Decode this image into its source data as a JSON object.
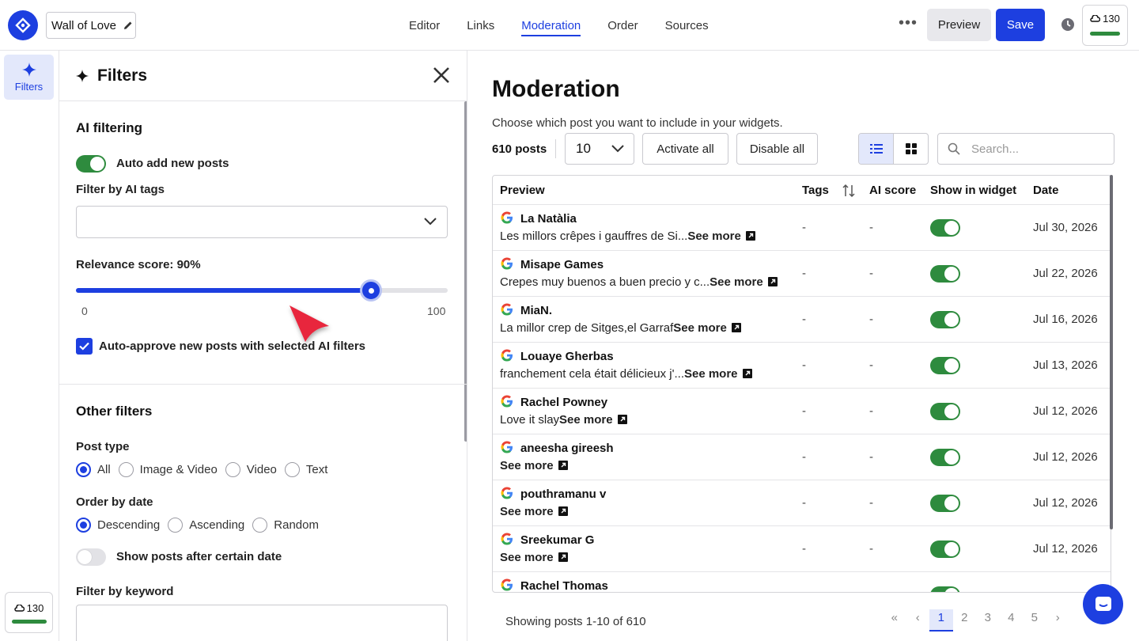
{
  "header": {
    "project_name": "Wall of Love",
    "tabs": [
      {
        "label": "Editor"
      },
      {
        "label": "Links"
      },
      {
        "label": "Moderation"
      },
      {
        "label": "Order"
      },
      {
        "label": "Sources"
      }
    ],
    "active_tab": "Moderation",
    "preview_label": "Preview",
    "save_label": "Save",
    "credits": "130"
  },
  "rail": {
    "filters_label": "Filters",
    "credits": "130"
  },
  "filters_panel": {
    "title": "Filters",
    "ai_filtering": {
      "title": "AI filtering",
      "auto_add_label": "Auto add new posts",
      "auto_add_on": true,
      "filter_tags_label": "Filter by AI tags",
      "relevance_label": "Relevance score: 90%",
      "relevance_value": 90,
      "slider_min": "0",
      "slider_max": "100",
      "auto_approve_label": "Auto-approve new posts with selected AI filters",
      "auto_approve_checked": true
    },
    "other_filters": {
      "title": "Other filters",
      "post_type_label": "Post type",
      "post_type_options": [
        "All",
        "Image & Video",
        "Video",
        "Text"
      ],
      "post_type_selected": "All",
      "order_label": "Order by date",
      "order_options": [
        "Descending",
        "Ascending",
        "Random"
      ],
      "order_selected": "Descending",
      "show_after_date_label": "Show posts after certain date",
      "show_after_date_on": false,
      "keyword_label": "Filter by keyword"
    }
  },
  "moderation": {
    "title": "Moderation",
    "subtitle": "Choose which post you want to include in your widgets.",
    "post_count": "610 posts",
    "per_page": "10",
    "activate_all": "Activate all",
    "disable_all": "Disable all",
    "search_placeholder": "Search...",
    "columns": [
      "Preview",
      "Tags",
      "AI score",
      "Show in widget",
      "Date"
    ],
    "rows": [
      {
        "name": "La Natàlia",
        "snippet": "Les millors crêpes i gauffres de Si...",
        "see_more": "See more",
        "tags": "-",
        "ai_score": "-",
        "shown": true,
        "date": "Jul 30, 2026"
      },
      {
        "name": "Misape Games",
        "snippet": "Crepes muy buenos a buen precio y c...",
        "see_more": "See more",
        "tags": "-",
        "ai_score": "-",
        "shown": true,
        "date": "Jul 22, 2026"
      },
      {
        "name": "MiaN.",
        "snippet": "La millor crep de Sitges,el Garraf",
        "see_more": "See more",
        "tags": "-",
        "ai_score": "-",
        "shown": true,
        "date": "Jul 16, 2026"
      },
      {
        "name": "Louaye Gherbas",
        "snippet": "franchement cela était délicieux j'...",
        "see_more": "See more",
        "tags": "-",
        "ai_score": "-",
        "shown": true,
        "date": "Jul 13, 2026"
      },
      {
        "name": "Rachel Powney",
        "snippet": "Love it slay",
        "see_more": "See more",
        "tags": "-",
        "ai_score": "-",
        "shown": true,
        "date": "Jul 12, 2026"
      },
      {
        "name": "aneesha gireesh",
        "snippet": "",
        "see_more": "See more",
        "tags": "-",
        "ai_score": "-",
        "shown": true,
        "date": "Jul 12, 2026"
      },
      {
        "name": "pouthramanu v",
        "snippet": "",
        "see_more": "See more",
        "tags": "-",
        "ai_score": "-",
        "shown": true,
        "date": "Jul 12, 2026"
      },
      {
        "name": "Sreekumar G",
        "snippet": "",
        "see_more": "See more",
        "tags": "-",
        "ai_score": "-",
        "shown": true,
        "date": "Jul 12, 2026"
      },
      {
        "name": "Rachel Thomas",
        "snippet": "",
        "see_more": "",
        "tags": "",
        "ai_score": "",
        "shown": true,
        "date": ""
      }
    ],
    "footer_text": "Showing posts 1-10 of 610",
    "pages": [
      "1",
      "2",
      "3",
      "4",
      "5"
    ],
    "current_page": "1"
  },
  "colors": {
    "accent": "#1d3fe0",
    "toggle_on": "#2e8b3e",
    "pointer": "#e8283c"
  }
}
